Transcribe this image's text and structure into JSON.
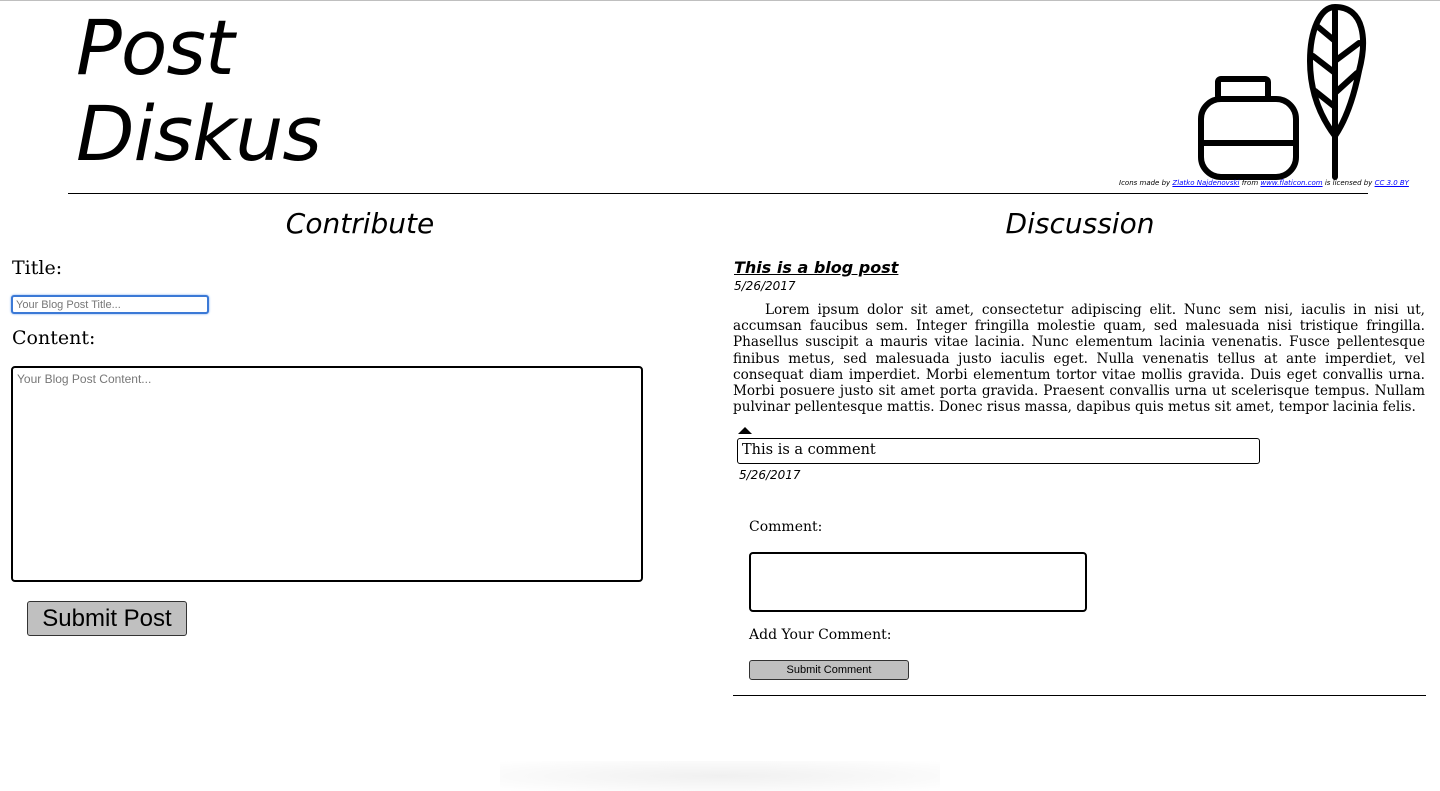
{
  "header": {
    "logo_line1": "Post",
    "logo_line2": "Diskus",
    "credit": {
      "prefix": "Icons made by ",
      "author": "Zlatko Najdenovski",
      "from": " from ",
      "site": "www.flaticon.com",
      "licensed": " is licensed by ",
      "license": "CC 3.0 BY"
    }
  },
  "contribute": {
    "heading": "Contribute",
    "title_label": "Title:",
    "title_placeholder": "Your Blog Post Title...",
    "content_label": "Content:",
    "content_placeholder": "Your Blog Post Content...",
    "submit_label": "Submit Post"
  },
  "discussion": {
    "heading": "Discussion",
    "post": {
      "title": "This is a blog post",
      "date": "5/26/2017",
      "body": "Lorem ipsum dolor sit amet, consectetur adipiscing elit. Nunc sem nisi, iaculis in nisi ut, accumsan faucibus sem. Integer fringilla molestie quam, sed malesuada nisi tristique fringilla. Phasellus suscipit a mauris vitae lacinia. Nunc elementum lacinia venenatis. Fusce pellentesque finibus metus, sed malesuada justo iaculis eget. Nulla venenatis tellus at ante imperdiet, vel consequat diam imperdiet. Morbi elementum tortor vitae mollis gravida. Duis eget convallis urna. Morbi posuere justo sit amet porta gravida. Praesent convallis urna ut scelerisque tempus. Nullam pulvinar pellentesque mattis. Donec risus massa, dapibus quis metus sit amet, tempor lacinia felis."
    },
    "comment": {
      "text": "This is a comment",
      "date": "5/26/2017"
    },
    "comment_label": "Comment:",
    "add_label": "Add Your Comment:",
    "submit_label": "Submit Comment"
  },
  "icons": {
    "logo_art": "ink-bottle-and-feather-icon",
    "vote": "upvote-arrow-icon"
  }
}
